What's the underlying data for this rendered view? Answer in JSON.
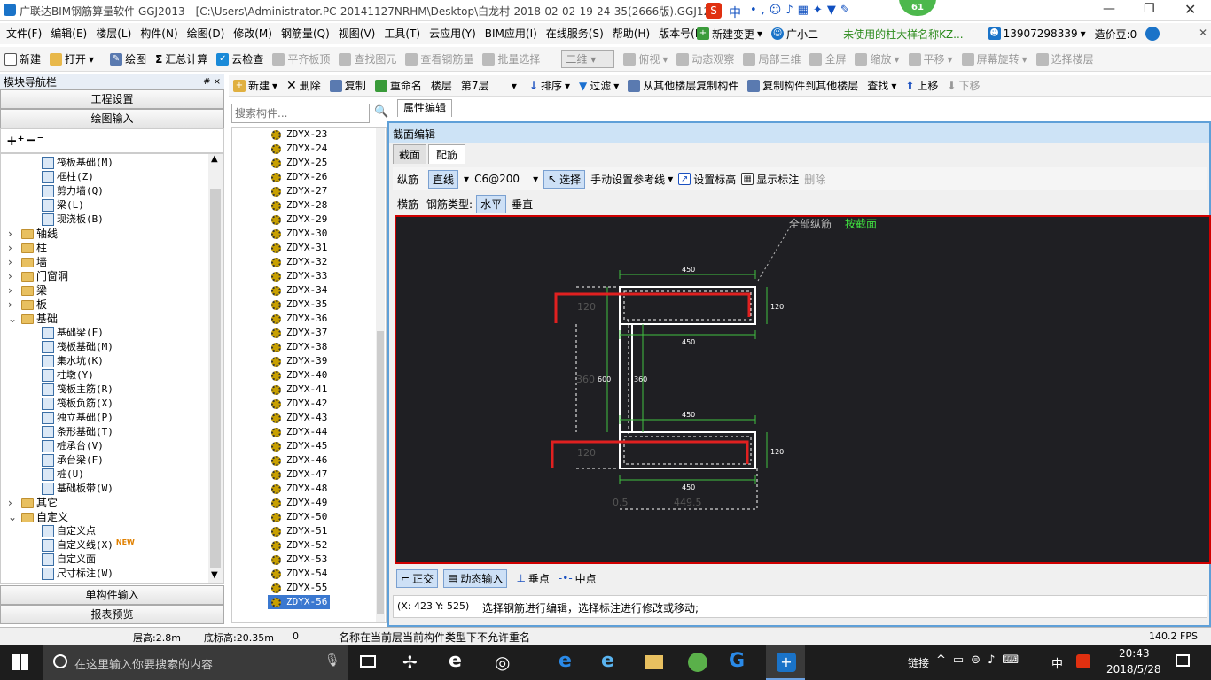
{
  "window": {
    "title": "广联达BIM钢筋算量软件 GGJ2013 - [C:\\Users\\Administrator.PC-20141127NRHM\\Desktop\\白龙村-2018-02-02-19-24-35(2666版).GGJ12]",
    "badge": "61",
    "ime": "中"
  },
  "menu": [
    "文件(F)",
    "编辑(E)",
    "楼层(L)",
    "构件(N)",
    "绘图(D)",
    "修改(M)",
    "钢筋量(Q)",
    "视图(V)",
    "工具(T)",
    "云应用(Y)",
    "BIM应用(I)",
    "在线服务(S)",
    "帮助(H)",
    "版本号(B)"
  ],
  "menu_right": {
    "new_change": "新建变更",
    "helper": "广小二",
    "notice": "未使用的柱大样名称KZ...",
    "phone": "13907298339",
    "price": "造价豆:0"
  },
  "toolbar1": {
    "items": [
      "新建",
      "打开",
      "绘图",
      "汇总计算",
      "云检查",
      "平齐板顶",
      "查找图元",
      "查看钢筋量",
      "批量选择"
    ],
    "view_select": "二维",
    "items2": [
      "俯视",
      "动态观察",
      "局部三维",
      "全屏",
      "缩放",
      "平移",
      "屏幕旋转",
      "选择楼层"
    ]
  },
  "nav": {
    "title": "模块导航栏",
    "pin": "# ×",
    "btn_project": "工程设置",
    "btn_draw": "绘图输入",
    "btn_single": "单构件输入",
    "btn_report": "报表预览",
    "tree": [
      {
        "label": "筏板基础(M)",
        "level": 2,
        "type": "item"
      },
      {
        "label": "框柱(Z)",
        "level": 2,
        "type": "item"
      },
      {
        "label": "剪力墙(Q)",
        "level": 2,
        "type": "item"
      },
      {
        "label": "梁(L)",
        "level": 2,
        "type": "item"
      },
      {
        "label": "现浇板(B)",
        "level": 2,
        "type": "item"
      },
      {
        "label": "轴线",
        "level": 1,
        "type": "folder",
        "exp": ">"
      },
      {
        "label": "柱",
        "level": 1,
        "type": "folder",
        "exp": ">"
      },
      {
        "label": "墙",
        "level": 1,
        "type": "folder",
        "exp": ">"
      },
      {
        "label": "门窗洞",
        "level": 1,
        "type": "folder",
        "exp": ">"
      },
      {
        "label": "梁",
        "level": 1,
        "type": "folder",
        "exp": ">"
      },
      {
        "label": "板",
        "level": 1,
        "type": "folder",
        "exp": ">"
      },
      {
        "label": "基础",
        "level": 1,
        "type": "folder",
        "exp": "v"
      },
      {
        "label": "基础梁(F)",
        "level": 2,
        "type": "item"
      },
      {
        "label": "筏板基础(M)",
        "level": 2,
        "type": "item"
      },
      {
        "label": "集水坑(K)",
        "level": 2,
        "type": "item"
      },
      {
        "label": "柱墩(Y)",
        "level": 2,
        "type": "item"
      },
      {
        "label": "筏板主筋(R)",
        "level": 2,
        "type": "item"
      },
      {
        "label": "筏板负筋(X)",
        "level": 2,
        "type": "item"
      },
      {
        "label": "独立基础(P)",
        "level": 2,
        "type": "item"
      },
      {
        "label": "条形基础(T)",
        "level": 2,
        "type": "item"
      },
      {
        "label": "桩承台(V)",
        "level": 2,
        "type": "item"
      },
      {
        "label": "承台梁(F)",
        "level": 2,
        "type": "item"
      },
      {
        "label": "桩(U)",
        "level": 2,
        "type": "item"
      },
      {
        "label": "基础板带(W)",
        "level": 2,
        "type": "item"
      },
      {
        "label": "其它",
        "level": 1,
        "type": "folder",
        "exp": ">"
      },
      {
        "label": "自定义",
        "level": 1,
        "type": "folder",
        "exp": "v"
      },
      {
        "label": "自定义点",
        "level": 2,
        "type": "item"
      },
      {
        "label": "自定义线(X)",
        "level": 2,
        "type": "item",
        "badge": "NEW"
      },
      {
        "label": "自定义面",
        "level": 2,
        "type": "item"
      },
      {
        "label": "尺寸标注(W)",
        "level": 2,
        "type": "item"
      }
    ]
  },
  "comp_toolbar": {
    "items": [
      "新建",
      "删除",
      "复制",
      "重命名"
    ],
    "floor_label": "楼层",
    "floor_value": "第7层",
    "items2": [
      "排序",
      "过滤",
      "从其他楼层复制构件",
      "复制构件到其他楼层",
      "查找",
      "上移",
      "下移"
    ]
  },
  "search_placeholder": "搜索构件...",
  "components": [
    "ZDYX-23",
    "ZDYX-24",
    "ZDYX-25",
    "ZDYX-26",
    "ZDYX-27",
    "ZDYX-28",
    "ZDYX-29",
    "ZDYX-30",
    "ZDYX-31",
    "ZDYX-32",
    "ZDYX-33",
    "ZDYX-34",
    "ZDYX-35",
    "ZDYX-36",
    "ZDYX-37",
    "ZDYX-38",
    "ZDYX-39",
    "ZDYX-40",
    "ZDYX-41",
    "ZDYX-42",
    "ZDYX-43",
    "ZDYX-44",
    "ZDYX-45",
    "ZDYX-46",
    "ZDYX-47",
    "ZDYX-48",
    "ZDYX-49",
    "ZDYX-50",
    "ZDYX-51",
    "ZDYX-52",
    "ZDYX-53",
    "ZDYX-54",
    "ZDYX-55",
    "ZDYX-56"
  ],
  "selected_component": "ZDYX-56",
  "prop_tab": "属性编辑",
  "section_editor": {
    "title": "截面编辑",
    "tabs": [
      "截面",
      "配筋"
    ],
    "row1": {
      "longi": "纵筋",
      "line": "直线",
      "spec": "C6@200",
      "select": "选择",
      "ref": "手动设置参考线",
      "elev": "设置标高",
      "show": "显示标注",
      "del": "删除"
    },
    "row2": {
      "trans": "横筋",
      "type_label": "钢筋类型:",
      "horiz": "水平",
      "vert": "垂直"
    },
    "canvas": {
      "label_all": "全部纵筋",
      "label_section": "按截面",
      "dims": {
        "top": "450",
        "mid1": "450",
        "mid2": "450",
        "bottom": "450",
        "h_top": "120",
        "h_bot": "120",
        "left_top": "120",
        "left_bot": "120",
        "v600": "600",
        "v360a": "360",
        "v360b": "360",
        "foot_a": "0.5",
        "foot_b": "449.5"
      }
    },
    "bottom": {
      "ortho": "正交",
      "dynamic": "动态输入",
      "perp": "垂点",
      "mid": "中点"
    },
    "coords": "(X: 423 Y: 525)",
    "hint": "选择钢筋进行编辑，选择标注进行修改或移动;"
  },
  "status": {
    "floor_h": "层高:2.8m",
    "base_h": "底标高:20.35m",
    "zero": "0",
    "msg": "名称在当前层当前构件类型下不允许重名",
    "fps": "140.2 FPS"
  },
  "taskbar": {
    "search": "在这里输入你要搜索的内容",
    "link": "链接",
    "ime": "中",
    "time": "20:43",
    "date": "2018/5/28"
  },
  "colors": {
    "rebar": "#e02020",
    "dim": "#40c040",
    "outline": "#ffffff",
    "canvas": "#1f1f23"
  }
}
